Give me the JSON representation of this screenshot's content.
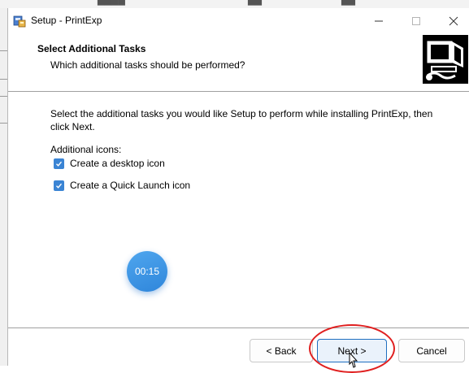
{
  "window": {
    "title": "Setup - PrintExp",
    "minimize_icon": "minimize-icon",
    "maximize_icon": "maximize-icon",
    "close_icon": "close-icon"
  },
  "header": {
    "title": "Select Additional Tasks",
    "subtitle": "Which additional tasks should be performed?"
  },
  "body": {
    "description": "Select the additional tasks you would like Setup to perform while installing PrintExp, then click Next.",
    "group_label": "Additional icons:",
    "tasks": [
      {
        "label": "Create a desktop icon",
        "checked": true
      },
      {
        "label": "Create a Quick Launch icon",
        "checked": true
      }
    ]
  },
  "timer": {
    "text": "00:15"
  },
  "buttons": {
    "back": "< Back",
    "next": "Next >",
    "cancel": "Cancel"
  },
  "colors": {
    "accent": "#3a84d4",
    "highlight": "#e02020",
    "timer": "#3b93e4"
  }
}
